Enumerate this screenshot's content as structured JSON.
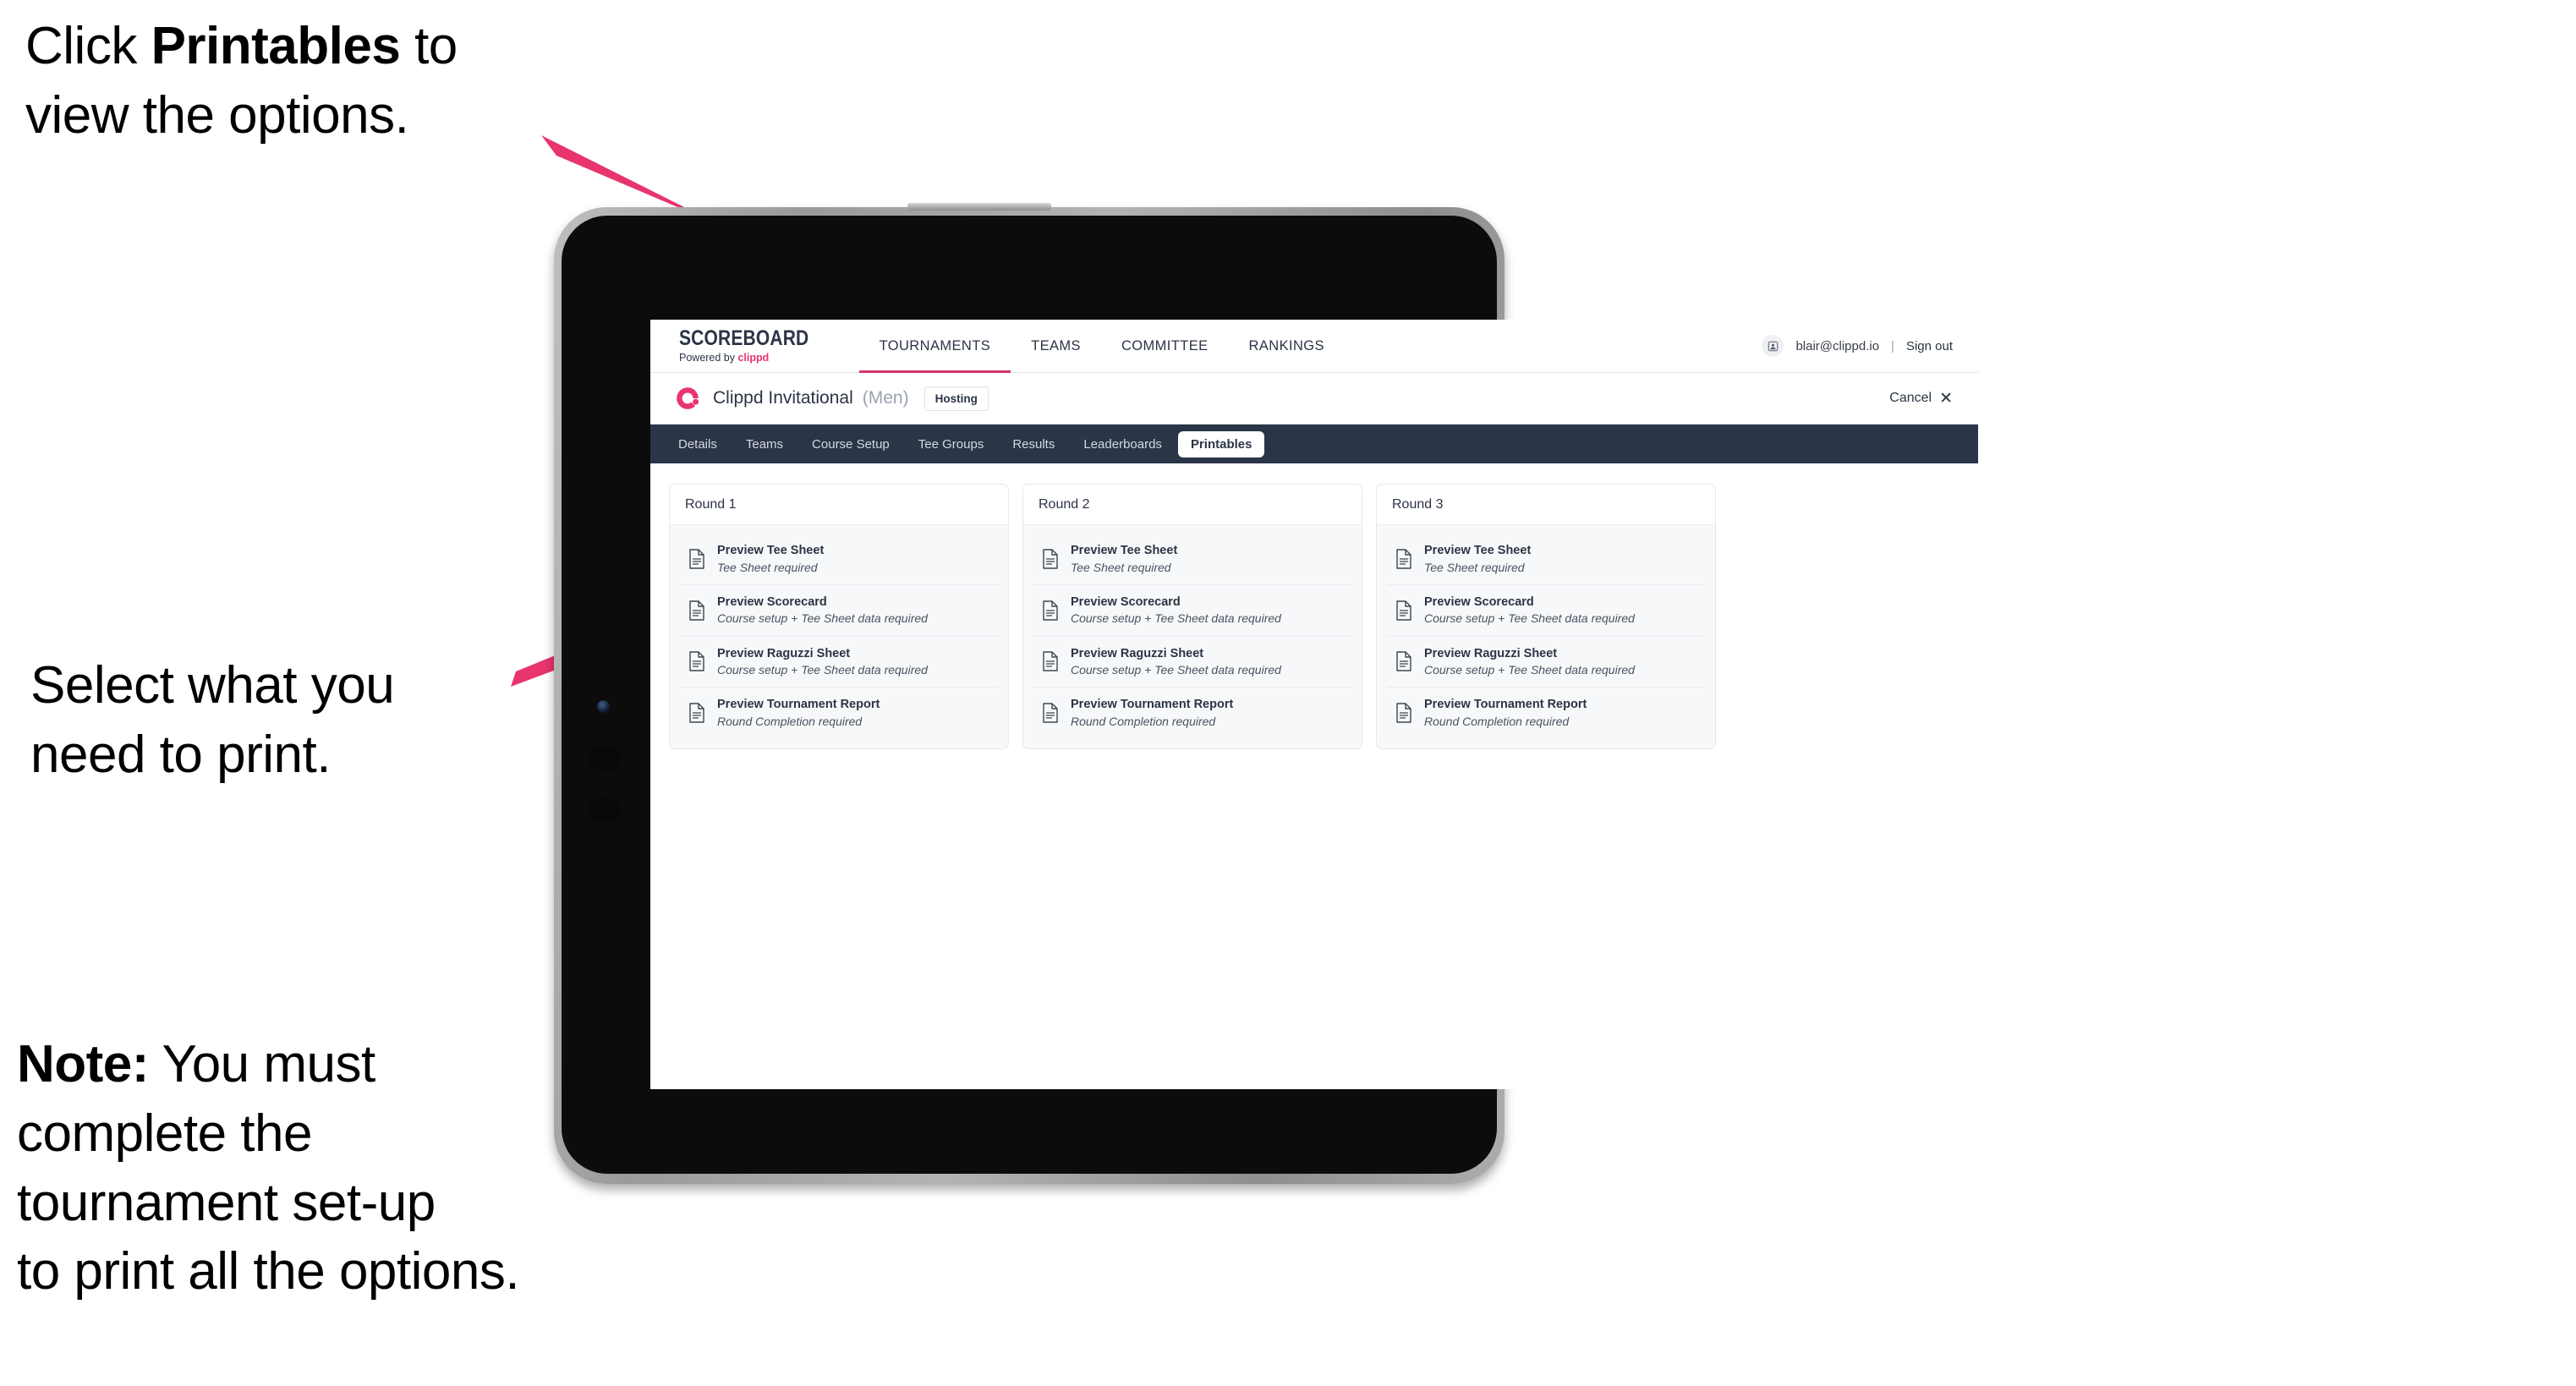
{
  "annotations": {
    "click_printables": "Click **Printables** to\nview the options.",
    "click_printables_plain_1": "Click ",
    "click_printables_bold": "Printables",
    "click_printables_plain_2": " to\nview the options.",
    "select_print": "Select what you\n need to print.",
    "note_bold": "Note:",
    "note_rest": " You must\ncomplete the\ntournament set-up\nto print all the options.",
    "arrow_color": "#e8356d"
  },
  "app": {
    "brand": {
      "title": "SCOREBOARD",
      "powered_by_text": "Powered by ",
      "powered_by_brand": "clippd"
    },
    "topnav": {
      "items": [
        {
          "label": "TOURNAMENTS",
          "active": true
        },
        {
          "label": "TEAMS",
          "active": false
        },
        {
          "label": "COMMITTEE",
          "active": false
        },
        {
          "label": "RANKINGS",
          "active": false
        }
      ],
      "user_email": "blair@clippd.io",
      "separator": "|",
      "sign_out": "Sign out",
      "avatar_icon": "user-avatar-icon"
    },
    "tournament_header": {
      "logo_icon": "clippd-c-logo-icon",
      "name": "Clippd Invitational",
      "gender": "(Men)",
      "status_badge": "Hosting",
      "cancel_label": "Cancel",
      "cancel_icon": "close-x-icon"
    },
    "subtabs": [
      {
        "label": "Details",
        "active": false
      },
      {
        "label": "Teams",
        "active": false
      },
      {
        "label": "Course Setup",
        "active": false
      },
      {
        "label": "Tee Groups",
        "active": false
      },
      {
        "label": "Results",
        "active": false
      },
      {
        "label": "Leaderboards",
        "active": false
      },
      {
        "label": "Printables",
        "active": true
      }
    ],
    "rounds": [
      {
        "title": "Round 1",
        "items": [
          {
            "title": "Preview Tee Sheet",
            "sub": "Tee Sheet required",
            "icon": "document-icon"
          },
          {
            "title": "Preview Scorecard",
            "sub": "Course setup + Tee Sheet data required",
            "icon": "document-icon"
          },
          {
            "title": "Preview Raguzzi Sheet",
            "sub": "Course setup + Tee Sheet data required",
            "icon": "document-icon"
          },
          {
            "title": "Preview Tournament Report",
            "sub": "Round Completion required",
            "icon": "document-icon"
          }
        ]
      },
      {
        "title": "Round 2",
        "items": [
          {
            "title": "Preview Tee Sheet",
            "sub": "Tee Sheet required",
            "icon": "document-icon"
          },
          {
            "title": "Preview Scorecard",
            "sub": "Course setup + Tee Sheet data required",
            "icon": "document-icon"
          },
          {
            "title": "Preview Raguzzi Sheet",
            "sub": "Course setup + Tee Sheet data required",
            "icon": "document-icon"
          },
          {
            "title": "Preview Tournament Report",
            "sub": "Round Completion required",
            "icon": "document-icon"
          }
        ]
      },
      {
        "title": "Round 3",
        "items": [
          {
            "title": "Preview Tee Sheet",
            "sub": "Tee Sheet required",
            "icon": "document-icon"
          },
          {
            "title": "Preview Scorecard",
            "sub": "Course setup + Tee Sheet data required",
            "icon": "document-icon"
          },
          {
            "title": "Preview Raguzzi Sheet",
            "sub": "Course setup + Tee Sheet data required",
            "icon": "document-icon"
          },
          {
            "title": "Preview Tournament Report",
            "sub": "Round Completion required",
            "icon": "document-icon"
          }
        ]
      }
    ]
  },
  "colors": {
    "accent_pink": "#e8356d",
    "nav_underline": "#d63566",
    "subtab_bar": "#2a3547",
    "text_dark": "#2b3445"
  }
}
